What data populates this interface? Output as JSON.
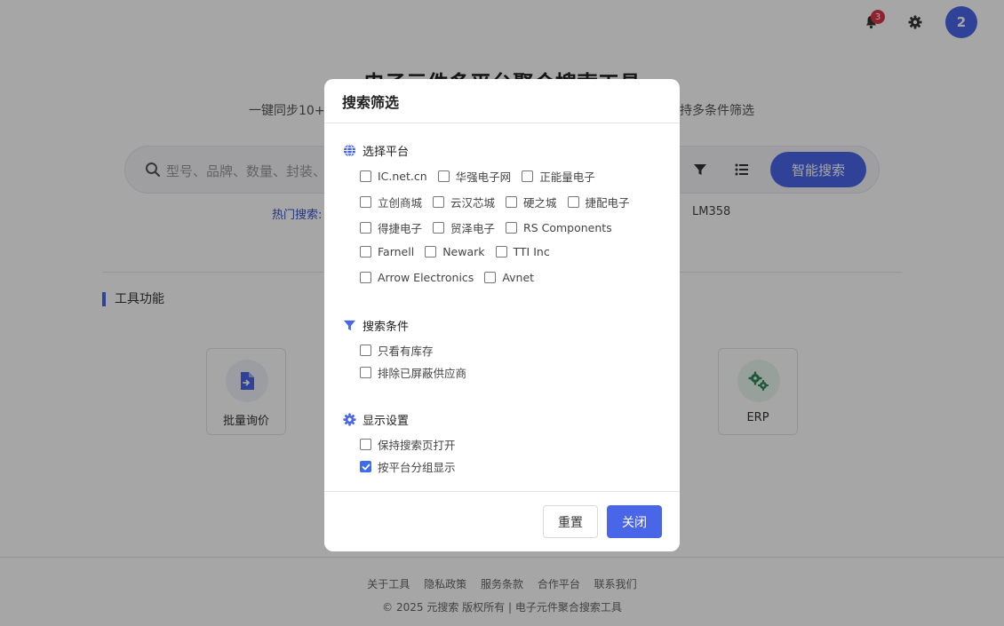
{
  "header": {
    "notification_count": "3",
    "avatar_label": "2"
  },
  "hero": {
    "title": "电子元件多平台聚合搜索工具",
    "subtitle_left": "一键同步10+平",
    "subtitle_right": "持多条件筛选"
  },
  "search": {
    "placeholder": "型号、品牌、数量、封装、",
    "button_label": "智能搜索",
    "hot_label": "热门搜索:",
    "hot_last": "LM358"
  },
  "tools": {
    "section_title": "工具功能",
    "cards": [
      {
        "label": "批量询价"
      },
      {
        "label": "ERP"
      }
    ]
  },
  "footer": {
    "links": [
      "关于工具",
      "隐私政策",
      "服务条款",
      "合作平台",
      "联系我们"
    ],
    "copyright": "© 2025 元搜索 版权所有 | 电子元件聚合搜索工具"
  },
  "modal": {
    "title": "搜索筛选",
    "platforms": {
      "heading": "选择平台",
      "rows": [
        [
          {
            "label": "IC.net.cn",
            "checked": false
          },
          {
            "label": "华强电子网",
            "checked": false
          },
          {
            "label": "正能量电子",
            "checked": false
          }
        ],
        [
          {
            "label": "立创商城",
            "checked": false
          },
          {
            "label": "云汉芯城",
            "checked": false
          },
          {
            "label": "硬之城",
            "checked": false
          },
          {
            "label": "捷配电子",
            "checked": false
          }
        ],
        [
          {
            "label": "得捷电子",
            "checked": false
          },
          {
            "label": "贸泽电子",
            "checked": false
          },
          {
            "label": "RS Components",
            "checked": false
          }
        ],
        [
          {
            "label": "Farnell",
            "checked": false
          },
          {
            "label": "Newark",
            "checked": false
          },
          {
            "label": "TTI Inc",
            "checked": false
          }
        ],
        [
          {
            "label": "Arrow Electronics",
            "checked": false
          },
          {
            "label": "Avnet",
            "checked": false
          }
        ]
      ]
    },
    "conditions": {
      "heading": "搜索条件",
      "items": [
        {
          "label": "只看有库存",
          "checked": false
        },
        {
          "label": "排除已屏蔽供应商",
          "checked": false
        }
      ]
    },
    "display": {
      "heading": "显示设置",
      "items": [
        {
          "label": "保持搜索页打开",
          "checked": false
        },
        {
          "label": "按平台分组显示",
          "checked": true
        }
      ]
    },
    "reset_label": "重置",
    "close_label": "关闭"
  },
  "colors": {
    "accent": "#4a66e8",
    "badge": "#dc3545",
    "checkbox_checked": "#3b6df0"
  }
}
